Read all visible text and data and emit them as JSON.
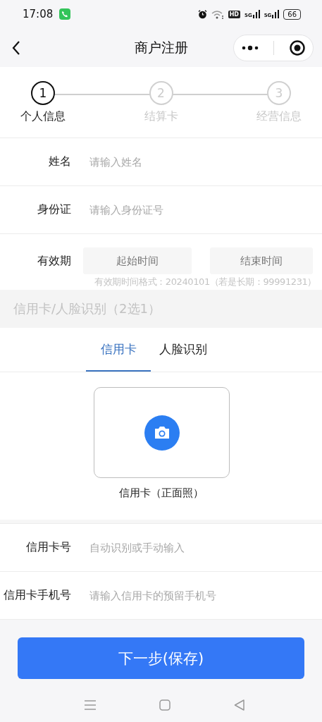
{
  "status_bar": {
    "time": "17:08",
    "hd": "HD",
    "signals": [
      "5G",
      "5G"
    ],
    "battery": "66"
  },
  "nav": {
    "title": "商户注册"
  },
  "steps": [
    {
      "number": "1",
      "label": "个人信息",
      "selected": true
    },
    {
      "number": "2",
      "label": "结算卡",
      "selected": false
    },
    {
      "number": "3",
      "label": "经营信息",
      "selected": false
    }
  ],
  "personal_fields": [
    {
      "label": "姓名",
      "placeholder": "请输入姓名"
    },
    {
      "label": "身份证",
      "placeholder": "请输入身份证号"
    }
  ],
  "validity": {
    "label": "有效期",
    "start_placeholder": "起始时间",
    "end_placeholder": "结束时间",
    "hint": "有效期时间格式：20240101（若是长期：99991231）"
  },
  "section": {
    "title": "信用卡/人脸识别（2选1）"
  },
  "tabs": [
    {
      "label": "信用卡",
      "selected": true
    },
    {
      "label": "人脸识别",
      "selected": false
    }
  ],
  "upload": {
    "caption": "信用卡（正面照）"
  },
  "card_fields": [
    {
      "label": "信用卡号",
      "placeholder": "自动识别或手动输入"
    },
    {
      "label": "信用卡手机号",
      "placeholder": "请输入信用卡的预留手机号"
    }
  ],
  "submit": {
    "label": "下一步(保存)"
  }
}
